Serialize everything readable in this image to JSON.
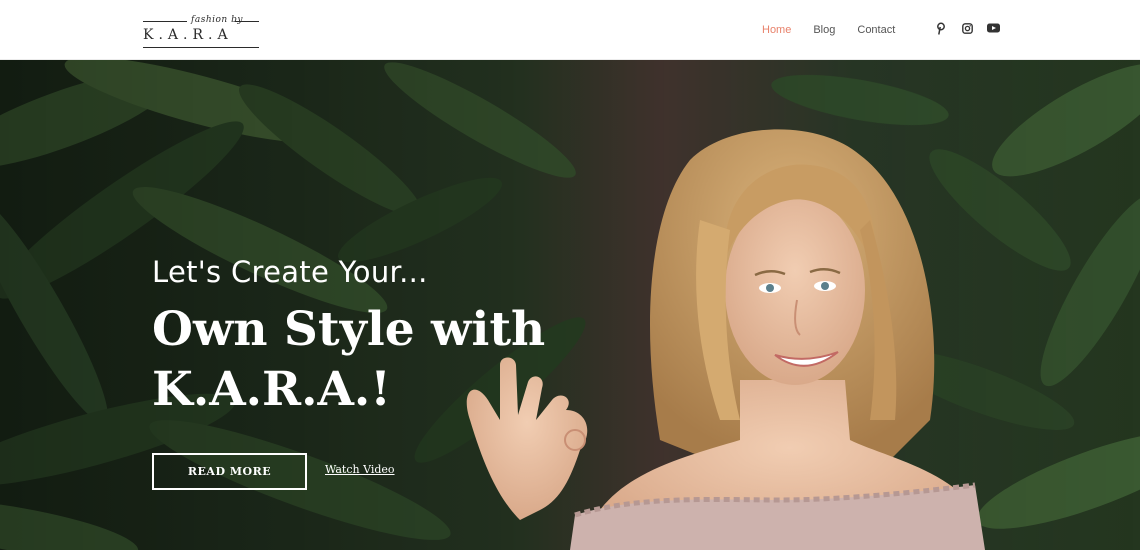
{
  "header": {
    "logo": {
      "script_text": "fashion by",
      "wordmark": "K.A.R.A"
    },
    "nav": [
      {
        "label": "Home",
        "active": true
      },
      {
        "label": "Blog",
        "active": false
      },
      {
        "label": "Contact",
        "active": false
      }
    ],
    "social_icons": [
      "pinterest-icon",
      "instagram-icon",
      "youtube-icon"
    ]
  },
  "hero": {
    "tagline": "Let's Create Your...",
    "headline_line1": "Own Style with",
    "headline_line2": "K.A.R.A.!",
    "read_more_label": "READ MORE",
    "watch_video_label": "Watch Video"
  },
  "colors": {
    "accent": "#e8826b",
    "nav_text": "#555555",
    "hero_text": "#ffffff",
    "foliage": "#2f4a2c"
  }
}
